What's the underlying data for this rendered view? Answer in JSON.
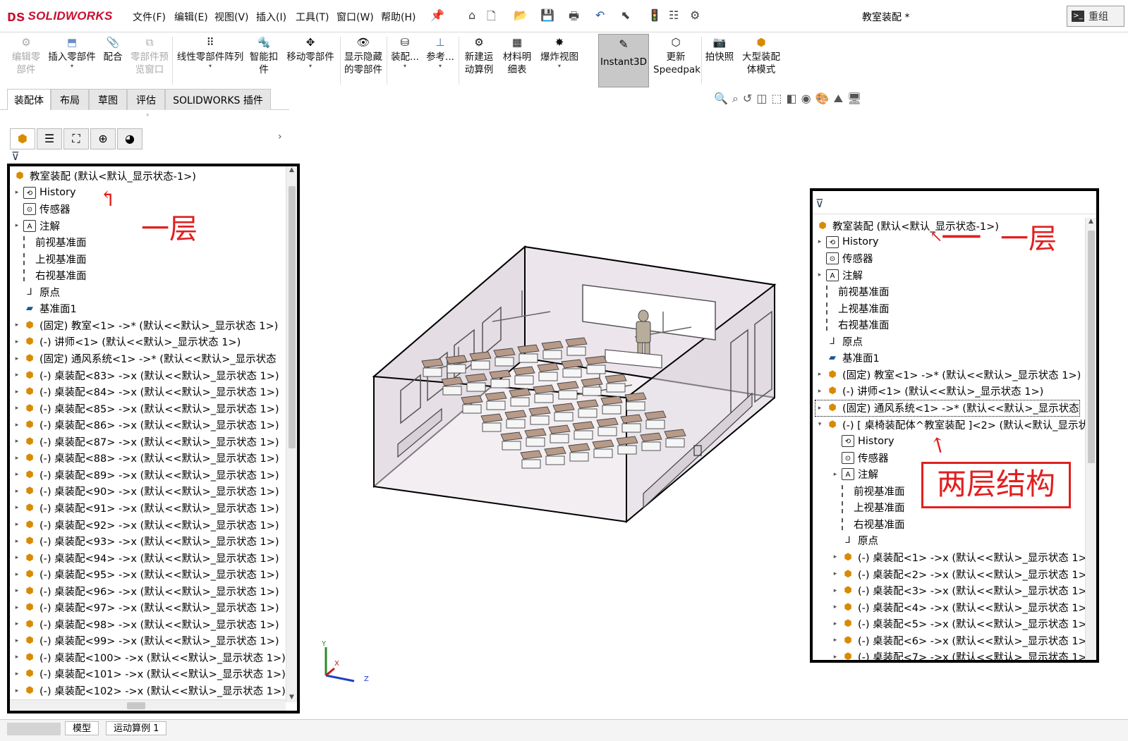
{
  "app": {
    "logo": "SOLIDWORKS",
    "doc_title": "教室装配 *",
    "rejoin": "重组"
  },
  "menu": [
    "文件(F)",
    "编辑(E)",
    "视图(V)",
    "插入(I)",
    "工具(T)",
    "窗口(W)",
    "帮助(H)"
  ],
  "ribbon": {
    "edit_part": "编辑零部件",
    "insert_part": "插入零部件",
    "mate": "配合",
    "preview_window": "零部件预览窗口",
    "linear_pattern": "线性零部件阵列",
    "smart_fastener": "智能扣件",
    "move_part": "移动零部件",
    "show_hidden": "显示隐藏的零部件",
    "assembly": "装配...",
    "reference": "参考...",
    "new_motion": "新建运动算例",
    "bom": "材料明细表",
    "explode": "爆炸视图",
    "instant3d": "Instant3D",
    "update_speedpak": "更新Speedpak",
    "snapshot": "拍快照",
    "large_assembly": "大型装配体模式"
  },
  "tabs": [
    "装配体",
    "布局",
    "草图",
    "评估",
    "SOLIDWORKS 插件"
  ],
  "left_tree": {
    "root": "教室装配 (默认<默认_显示状态-1>)",
    "items": [
      {
        "arrow": "▸",
        "icon": "history-icon",
        "label": "History"
      },
      {
        "arrow": "",
        "icon": "sensor-icon",
        "label": "传感器"
      },
      {
        "arrow": "▸",
        "icon": "annotation-icon",
        "label": "注解"
      },
      {
        "arrow": "",
        "icon": "plane-icon",
        "label": "前视基准面"
      },
      {
        "arrow": "",
        "icon": "plane-icon",
        "label": "上视基准面"
      },
      {
        "arrow": "",
        "icon": "plane-icon",
        "label": "右视基准面"
      },
      {
        "arrow": "",
        "icon": "origin-icon",
        "label": "原点"
      },
      {
        "arrow": "",
        "icon": "ref-plane-icon",
        "label": "基准面1"
      },
      {
        "arrow": "▸",
        "icon": "assembly-icon",
        "label": "(固定) 教室<1> ->* (默认<<默认>_显示状态 1>)"
      },
      {
        "arrow": "▸",
        "icon": "assembly-icon",
        "label": "(-) 讲师<1> (默认<<默认>_显示状态 1>)"
      },
      {
        "arrow": "▸",
        "icon": "assembly-icon",
        "label": "(固定) 通风系统<1> ->* (默认<<默认>_显示状态"
      },
      {
        "arrow": "▸",
        "icon": "assembly-icon",
        "label": "(-) 桌装配<83> ->x (默认<<默认>_显示状态 1>)"
      },
      {
        "arrow": "▸",
        "icon": "assembly-icon",
        "label": "(-) 桌装配<84> ->x (默认<<默认>_显示状态 1>)"
      },
      {
        "arrow": "▸",
        "icon": "assembly-icon",
        "label": "(-) 桌装配<85> ->x (默认<<默认>_显示状态 1>)"
      },
      {
        "arrow": "▸",
        "icon": "assembly-icon",
        "label": "(-) 桌装配<86> ->x (默认<<默认>_显示状态 1>)"
      },
      {
        "arrow": "▸",
        "icon": "assembly-icon",
        "label": "(-) 桌装配<87> ->x (默认<<默认>_显示状态 1>)"
      },
      {
        "arrow": "▸",
        "icon": "assembly-icon",
        "label": "(-) 桌装配<88> ->x (默认<<默认>_显示状态 1>)"
      },
      {
        "arrow": "▸",
        "icon": "assembly-icon",
        "label": "(-) 桌装配<89> ->x (默认<<默认>_显示状态 1>)"
      },
      {
        "arrow": "▸",
        "icon": "assembly-icon",
        "label": "(-) 桌装配<90> ->x (默认<<默认>_显示状态 1>)"
      },
      {
        "arrow": "▸",
        "icon": "assembly-icon",
        "label": "(-) 桌装配<91> ->x (默认<<默认>_显示状态 1>)"
      },
      {
        "arrow": "▸",
        "icon": "assembly-icon",
        "label": "(-) 桌装配<92> ->x (默认<<默认>_显示状态 1>)"
      },
      {
        "arrow": "▸",
        "icon": "assembly-icon",
        "label": "(-) 桌装配<93> ->x (默认<<默认>_显示状态 1>)"
      },
      {
        "arrow": "▸",
        "icon": "assembly-icon",
        "label": "(-) 桌装配<94> ->x (默认<<默认>_显示状态 1>)"
      },
      {
        "arrow": "▸",
        "icon": "assembly-icon",
        "label": "(-) 桌装配<95> ->x (默认<<默认>_显示状态 1>)"
      },
      {
        "arrow": "▸",
        "icon": "assembly-icon",
        "label": "(-) 桌装配<96> ->x (默认<<默认>_显示状态 1>)"
      },
      {
        "arrow": "▸",
        "icon": "assembly-icon",
        "label": "(-) 桌装配<97> ->x (默认<<默认>_显示状态 1>)"
      },
      {
        "arrow": "▸",
        "icon": "assembly-icon",
        "label": "(-) 桌装配<98> ->x (默认<<默认>_显示状态 1>)"
      },
      {
        "arrow": "▸",
        "icon": "assembly-icon",
        "label": "(-) 桌装配<99> ->x (默认<<默认>_显示状态 1>)"
      },
      {
        "arrow": "▸",
        "icon": "assembly-icon",
        "label": "(-) 桌装配<100> ->x (默认<<默认>_显示状态 1>)"
      },
      {
        "arrow": "▸",
        "icon": "assembly-icon",
        "label": "(-) 桌装配<101> ->x (默认<<默认>_显示状态 1>)"
      },
      {
        "arrow": "▸",
        "icon": "assembly-icon",
        "label": "(-) 桌装配<102> ->x (默认<<默认>_显示状态 1>)"
      }
    ]
  },
  "right_tree": {
    "root": "教室装配 (默认<默认_显示状态-1>)",
    "items": [
      {
        "arrow": "▸",
        "icon": "history-icon",
        "label": "History",
        "indent": 0
      },
      {
        "arrow": "",
        "icon": "sensor-icon",
        "label": "传感器",
        "indent": 0
      },
      {
        "arrow": "▸",
        "icon": "annotation-icon",
        "label": "注解",
        "indent": 0
      },
      {
        "arrow": "",
        "icon": "plane-icon",
        "label": "前视基准面",
        "indent": 0
      },
      {
        "arrow": "",
        "icon": "plane-icon",
        "label": "上视基准面",
        "indent": 0
      },
      {
        "arrow": "",
        "icon": "plane-icon",
        "label": "右视基准面",
        "indent": 0
      },
      {
        "arrow": "",
        "icon": "origin-icon",
        "label": "原点",
        "indent": 0
      },
      {
        "arrow": "",
        "icon": "ref-plane-icon",
        "label": "基准面1",
        "indent": 0
      },
      {
        "arrow": "▸",
        "icon": "assembly-icon",
        "label": "(固定) 教室<1> ->* (默认<<默认>_显示状态 1>)",
        "indent": 0
      },
      {
        "arrow": "▸",
        "icon": "assembly-icon",
        "label": "(-) 讲师<1> (默认<<默认>_显示状态 1>)",
        "indent": 0
      },
      {
        "arrow": "▸",
        "icon": "assembly-icon",
        "label": "(固定) 通风系统<1> ->* (默认<<默认>_显示状态",
        "indent": 0,
        "selected": true
      },
      {
        "arrow": "▾",
        "icon": "assembly-icon",
        "label": "(-) [ 桌椅装配体^教室装配 ]<2> (默认<默认_显示状",
        "indent": 0
      },
      {
        "arrow": "",
        "icon": "history-icon",
        "label": "History",
        "indent": 1
      },
      {
        "arrow": "",
        "icon": "sensor-icon",
        "label": "传感器",
        "indent": 1
      },
      {
        "arrow": "▸",
        "icon": "annotation-icon",
        "label": "注解",
        "indent": 1
      },
      {
        "arrow": "",
        "icon": "plane-icon",
        "label": "前视基准面",
        "indent": 1
      },
      {
        "arrow": "",
        "icon": "plane-icon",
        "label": "上视基准面",
        "indent": 1
      },
      {
        "arrow": "",
        "icon": "plane-icon",
        "label": "右视基准面",
        "indent": 1
      },
      {
        "arrow": "",
        "icon": "origin-icon",
        "label": "原点",
        "indent": 1
      },
      {
        "arrow": "▸",
        "icon": "assembly-icon",
        "label": "(-) 桌装配<1> ->x (默认<<默认>_显示状态 1>",
        "indent": 1
      },
      {
        "arrow": "▸",
        "icon": "assembly-icon",
        "label": "(-) 桌装配<2> ->x (默认<<默认>_显示状态 1>",
        "indent": 1
      },
      {
        "arrow": "▸",
        "icon": "assembly-icon",
        "label": "(-) 桌装配<3> ->x (默认<<默认>_显示状态 1>",
        "indent": 1
      },
      {
        "arrow": "▸",
        "icon": "assembly-icon",
        "label": "(-) 桌装配<4> ->x (默认<<默认>_显示状态 1>",
        "indent": 1
      },
      {
        "arrow": "▸",
        "icon": "assembly-icon",
        "label": "(-) 桌装配<5> ->x (默认<<默认>_显示状态 1>",
        "indent": 1
      },
      {
        "arrow": "▸",
        "icon": "assembly-icon",
        "label": "(-) 桌装配<6> ->x (默认<<默认>_显示状态 1>",
        "indent": 1
      },
      {
        "arrow": "▸",
        "icon": "assembly-icon",
        "label": "(-) 桌装配<7> ->x (默认<<默认>_显示状态 1>",
        "indent": 1
      }
    ]
  },
  "annotations": {
    "left_layer": "一层",
    "right_layer": "一层",
    "two_layer": "两层结构"
  },
  "triad": {
    "x": "X",
    "y": "Y",
    "z": "Z"
  },
  "status_tabs": [
    "模型",
    "运动算例 1"
  ],
  "colors": {
    "annotation": "#e02020",
    "brand": "#c8102e",
    "room_fill": "#ece6ec"
  }
}
